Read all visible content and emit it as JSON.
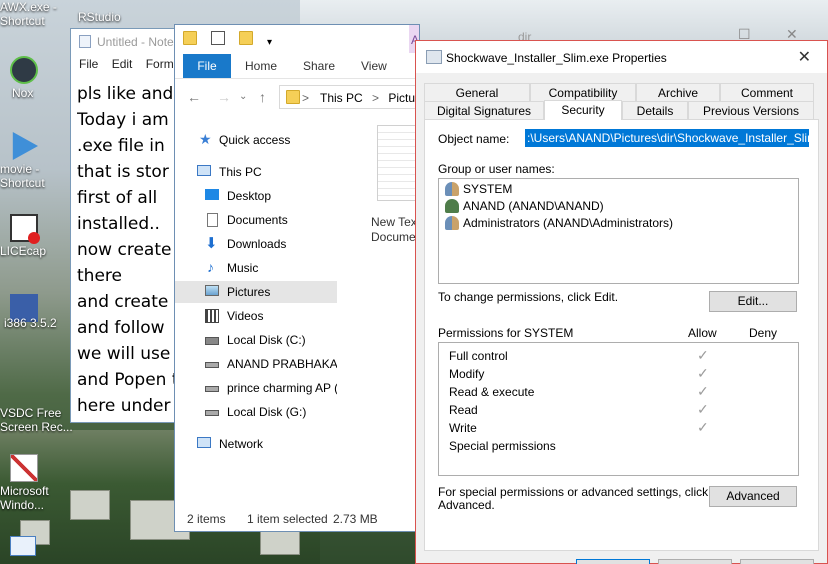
{
  "desktop": {
    "icons": [
      {
        "label": "AWX.exe -\nShortcut"
      },
      {
        "label": "Nox"
      },
      {
        "label": "movie -\nShortcut"
      },
      {
        "label": "LICEcap"
      },
      {
        "label": "i386 3.5.2"
      },
      {
        "label": "VSDC Free\nScreen Rec..."
      },
      {
        "label": "Microsoft\nWindo..."
      },
      {
        "label": "RStudio"
      }
    ]
  },
  "notepad": {
    "title": "Untitled - Notepad",
    "menu": [
      "File",
      "Edit",
      "Format"
    ],
    "lines": [
      "pls like and",
      "Today i am",
      ".exe file in",
      "that is stor",
      "first of all",
      "installed..",
      "now create",
      "there",
      "and create",
      "and follow",
      "we will use",
      "and Popen t",
      "here under"
    ]
  },
  "explorer": {
    "title": "dir",
    "app_tools": "Application Tools",
    "tabs": {
      "file": "File",
      "home": "Home",
      "share": "Share",
      "view": "View"
    },
    "address": {
      "this_pc": "This PC",
      "sep": ">",
      "pictures": "Pictures"
    },
    "nav": [
      {
        "label": "Quick access",
        "icon": "star-icon"
      },
      {
        "label": "This PC",
        "icon": "pc-icon"
      },
      {
        "label": "Desktop",
        "icon": "desktop-icon"
      },
      {
        "label": "Documents",
        "icon": "documents-icon"
      },
      {
        "label": "Downloads",
        "icon": "downloads-icon"
      },
      {
        "label": "Music",
        "icon": "music-icon"
      },
      {
        "label": "Pictures",
        "icon": "pictures-icon"
      },
      {
        "label": "Videos",
        "icon": "videos-icon"
      },
      {
        "label": "Local Disk (C:)",
        "icon": "drive-icon"
      },
      {
        "label": "ANAND PRABHAKAR",
        "icon": "drive-icon"
      },
      {
        "label": "prince charming AP (",
        "icon": "drive-icon"
      },
      {
        "label": "Local Disk (G:)",
        "icon": "drive-icon"
      },
      {
        "label": "Network",
        "icon": "network-icon"
      }
    ],
    "file_label_1": "New Tex",
    "file_label_2": "Docume",
    "status": {
      "items": "2 items",
      "selected": "1 item selected",
      "size": "2.73 MB"
    }
  },
  "properties": {
    "title": "Shockwave_Installer_Slim.exe Properties",
    "tabs_row1": [
      "General",
      "Compatibility",
      "Archive",
      "Comment"
    ],
    "tabs_row2": [
      "Digital Signatures",
      "Security",
      "Details",
      "Previous Versions"
    ],
    "active_tab": "Security",
    "object_name_label": "Object name:",
    "object_name_value": ":\\Users\\ANAND\\Pictures\\dir\\Shockwave_Installer_Slim.exe",
    "group_label": "Group or user names:",
    "users": [
      {
        "name": "SYSTEM",
        "icon": "group-icon"
      },
      {
        "name": "ANAND (ANAND\\ANAND)",
        "icon": "user-icon"
      },
      {
        "name": "Administrators (ANAND\\Administrators)",
        "icon": "group-icon"
      }
    ],
    "change_text": "To change permissions, click Edit.",
    "edit_button": "Edit...",
    "perms_label": "Permissions for SYSTEM",
    "allow_header": "Allow",
    "deny_header": "Deny",
    "permissions": [
      {
        "name": "Full control",
        "allow": true
      },
      {
        "name": "Modify",
        "allow": true
      },
      {
        "name": "Read & execute",
        "allow": true
      },
      {
        "name": "Read",
        "allow": true
      },
      {
        "name": "Write",
        "allow": true
      },
      {
        "name": "Special permissions",
        "allow": false
      }
    ],
    "special_text_1": "For special permissions or advanced settings, click",
    "special_text_2": "Advanced.",
    "advanced_button": "Advanced"
  }
}
